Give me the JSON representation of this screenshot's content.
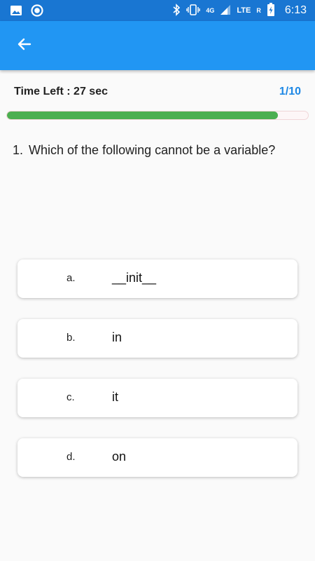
{
  "status_bar": {
    "time": "6:13",
    "network": "4G",
    "carrier": "LTE",
    "roaming": "R",
    "icons": [
      "image-icon",
      "circle-icon",
      "bluetooth-icon",
      "vibrate-icon",
      "signal-icon",
      "battery-icon"
    ]
  },
  "app_bar": {
    "back_icon": "arrow-left-icon",
    "color": "#2196f3"
  },
  "quiz": {
    "time_left": "Time Left : 27 sec",
    "counter": "1/10",
    "progress": 0.9
  },
  "question": {
    "number": "1.",
    "text": "Which of the following cannot be a variable?"
  },
  "options": [
    {
      "letter": "a.",
      "text": "__init__"
    },
    {
      "letter": "b.",
      "text": "in"
    },
    {
      "letter": "c.",
      "text": "it"
    },
    {
      "letter": "d.",
      "text": "on"
    }
  ],
  "colors": {
    "status_bar": "#1976d2",
    "accent": "#1e88e5",
    "progress": "#4caf50"
  }
}
